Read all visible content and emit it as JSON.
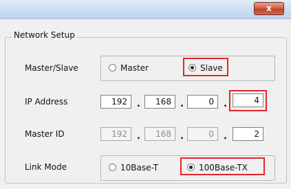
{
  "window": {
    "close_label": "x"
  },
  "group": {
    "title": "Network Setup"
  },
  "master_slave": {
    "label": "Master/Slave",
    "options": [
      "Master",
      "Slave"
    ],
    "selected": "Slave"
  },
  "ip_address": {
    "label": "IP Address",
    "octets": [
      "192",
      "168",
      "0",
      "4"
    ],
    "separator": "."
  },
  "master_id": {
    "label": "Master ID",
    "octets": [
      "192",
      "168",
      "0",
      "2"
    ],
    "separator": "."
  },
  "link_mode": {
    "label": "Link Mode",
    "options": [
      "10Base-T",
      "100Base-TX"
    ],
    "selected": "100Base-TX"
  },
  "colors": {
    "highlight": "#e0262b",
    "titlebar": "#cfdff2",
    "close_button": "#c2402a"
  }
}
